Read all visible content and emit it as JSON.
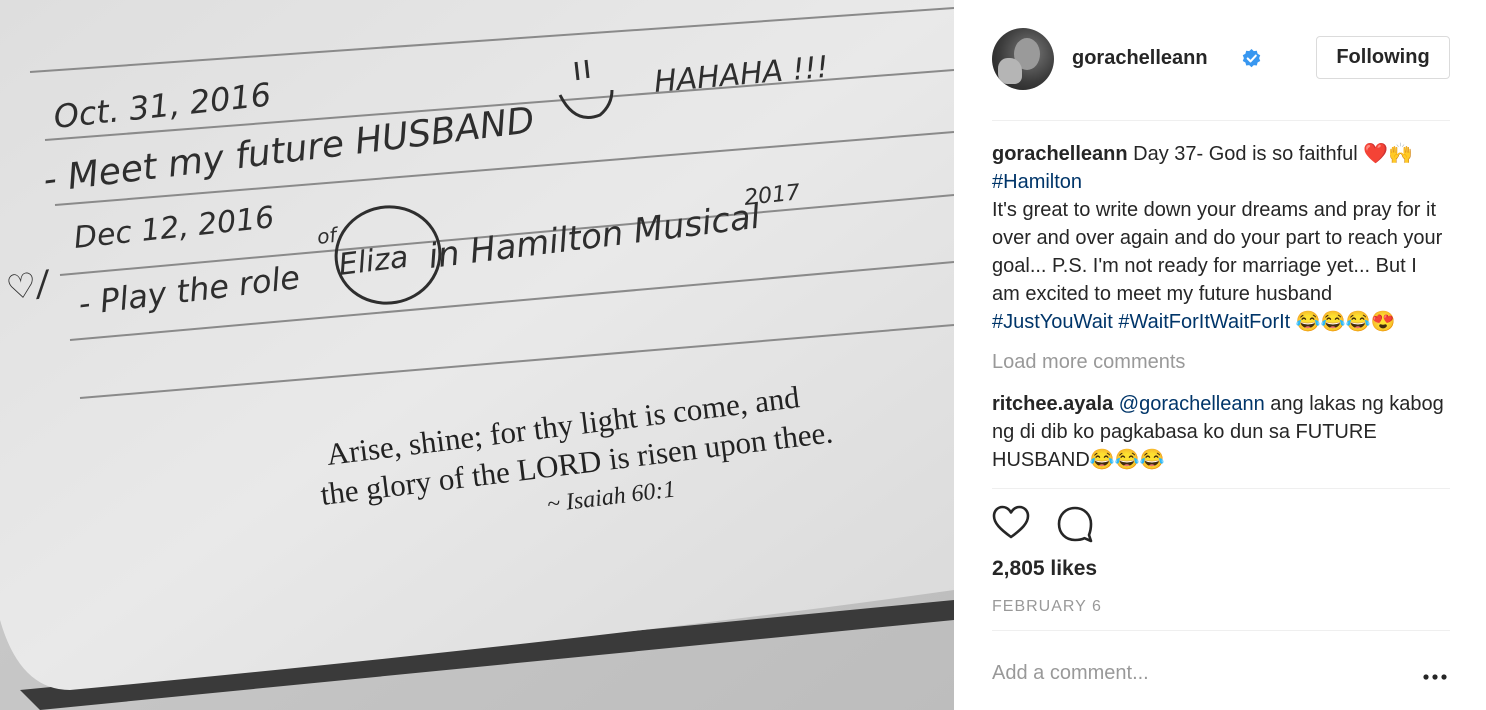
{
  "photo": {
    "notes": {
      "line1_date": "Oct. 31, 2016",
      "line2": "- Meet my future HUSBAND",
      "line2_laugh": "HAHAHA !!!",
      "line3_date": "Dec 12, 2016",
      "line4_pre": "- Play the role",
      "line4_of": "of",
      "line4_circled": "Eliza",
      "line4_post": "in Hamilton Musical",
      "line4_year": "2017",
      "check_mark": "♡/"
    },
    "verse": {
      "line1": "Arise, shine; for thy light is come, and",
      "line2": "the glory of the LORD is risen upon thee.",
      "reference": "~ Isaiah 60:1"
    }
  },
  "post": {
    "username": "gorachelleann",
    "follow_label": "Following",
    "caption": {
      "username": "gorachelleann",
      "text_start": " Day 37- God is so faithful ",
      "emoji_1": "❤️🙌",
      "tag_1": "#Hamilton",
      "text_body": "It's great to write down your dreams and pray for it over and over again and do your part to reach your goal... P.S. I'm not ready for marriage yet... But I am excited to meet my future husband ",
      "tag_2": "#JustYouWait",
      "tag_3": "#WaitForItWaitForIt",
      "emoji_2": " 😂😂😂😍"
    },
    "load_more": "Load more comments",
    "comment_1": {
      "username": "ritchee.ayala",
      "mention": "@gorachelleann",
      "text": " ang lakas ng kabog ng di dib ko pagkabasa ko dun sa FUTURE HUSBAND😂😂😂"
    },
    "likes": "2,805 likes",
    "date": "FEBRUARY 6",
    "add_comment_placeholder": "Add a comment...",
    "icons": [
      "heart-icon",
      "comment-icon",
      "more-options-icon",
      "verified-badge-icon"
    ],
    "colors": {
      "link": "#003569",
      "verified": "#3897f0",
      "muted": "#999999",
      "text": "#262626"
    }
  }
}
